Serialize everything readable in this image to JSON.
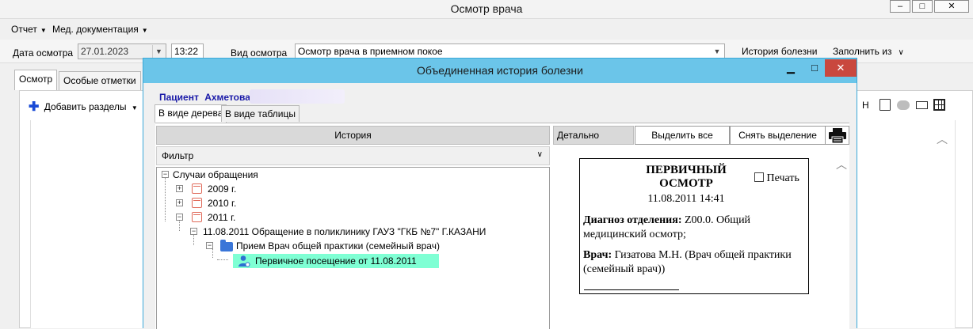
{
  "main_window": {
    "title": "Осмотр врача",
    "controls": {
      "minimize": "–",
      "maximize": "□",
      "close": "✕"
    }
  },
  "menu": [
    {
      "label": "Отчет"
    },
    {
      "label": "Мед. документация"
    }
  ],
  "toolbar": {
    "date_label": "Дата осмотра",
    "date_value": "27.01.2023",
    "time_value": "13:22",
    "type_label": "Вид осмотра",
    "type_value": "Осмотр врача в приемном покое",
    "history_button": "История болезни",
    "fill_from_button": "Заполнить из"
  },
  "tabs": [
    {
      "label": "Осмотр",
      "active": true
    },
    {
      "label": "Особые отметки",
      "active": false
    }
  ],
  "add_sections_button": "Добавить разделы",
  "right_toolbar_text": "Н",
  "dialog": {
    "title": "Объединенная история болезни",
    "patient_label": "Пациент",
    "patient_name": "Ахметова",
    "subtabs": [
      {
        "label": "В виде дерева",
        "active": true
      },
      {
        "label": "В виде таблицы",
        "active": false
      }
    ],
    "history_header": "История",
    "filter_label": "Фильтр",
    "tree": {
      "root": "Случаи обращения",
      "years": [
        "2009 г.",
        "2010 г.",
        "2011 г."
      ],
      "case": "11.08.2011 Обращение в поликлинику ГАУЗ \"ГКБ №7\" Г.КАЗАНИ",
      "reception": "Прием Врач общей практики (семейный врач)",
      "visit": "Первичное посещение от 11.08.2011"
    },
    "detail_label": "Детально",
    "select_all_button": "Выделить все",
    "deselect_button": "Снять выделение",
    "document": {
      "title_line1": "ПЕРВИЧНЫЙ",
      "title_line2": "ОСМОТР",
      "print_label": "Печать",
      "datetime": "11.08.2011 14:41",
      "diagnosis_label": "Диагноз отделения:",
      "diagnosis_text": "Z00.0. Общий медицинский осмотр;",
      "doctor_label": "Врач:",
      "doctor_text": "Гизатова М.Н. (Врач общей практики (семейный врач))"
    }
  },
  "colors": {
    "dialog_titlebar": "#6bc5e9",
    "selected_node": "#7fffd4",
    "patient_text": "#1a1aa8",
    "close_button": "#c9483e"
  }
}
